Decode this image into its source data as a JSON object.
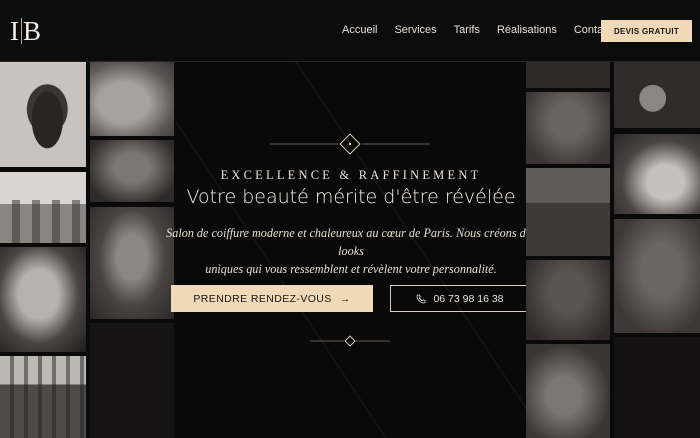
{
  "brand": {
    "logo_left": "I",
    "logo_right": "B"
  },
  "nav": {
    "items": [
      "Accueil",
      "Services",
      "Tarifs",
      "Réalisations",
      "Contact"
    ],
    "cta_label": "DEVIS GRATUIT"
  },
  "hero": {
    "tagline": "EXCELLENCE & RAFFINEMENT",
    "headline": "Votre beauté mérite d'être révélée",
    "description_line1": "Salon de coiffure moderne et chaleureux au cœur de Paris. Nous créons des looks",
    "description_line2": "uniques qui vous ressemblent et révèlent votre personnalité.",
    "primary_button": "PRENDRE RENDEZ-VOUS",
    "primary_icon": "→",
    "secondary_button": "06 73 98 16 38",
    "secondary_icon": "phone-icon"
  },
  "colors": {
    "accent": "#f1d9b8",
    "background": "#0b0a0a",
    "text": "#e9e1d6"
  }
}
